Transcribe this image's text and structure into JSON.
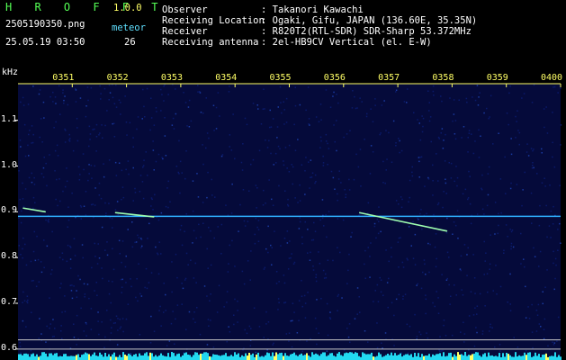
{
  "header": {
    "app_title": "H R O F F T",
    "app_version": "1.0.0",
    "filename": "2505190350.png",
    "datetime": "25.05.19 03:50",
    "count_label": "meteor",
    "count_value": "26",
    "info": [
      {
        "label": "Observer",
        "value": ": Takanori Kawachi"
      },
      {
        "label": "Receiving Location",
        "value": ": Ogaki, Gifu, JAPAN (136.60E, 35.35N)"
      },
      {
        "label": "Receiver",
        "value": ": R820T2(RTL-SDR) SDR-Sharp 53.372MHz"
      },
      {
        "label": "Receiving antenna",
        "value": ": 2el-HB9CV Vertical (el. E-W)"
      }
    ]
  },
  "colors": {
    "background": "#000000",
    "cyan_text": "#5fe0ff",
    "yellow_text": "#ffff66",
    "green_text": "#55ff55",
    "noise": "#0a1a6a",
    "carrier": "#2fb0ff",
    "meteor": "#9fffb0"
  },
  "chart_data": {
    "type": "heatmap",
    "ylabel": "kHz",
    "y_ticks": [
      "1.1",
      "1.0",
      "0.9",
      "0.8",
      "0.7",
      "0.6"
    ],
    "x_ticks": [
      "0351",
      "0352",
      "0353",
      "0354",
      "0355",
      "0356",
      "0357",
      "0358",
      "0359",
      "0400"
    ],
    "ylim": [
      0.58,
      1.18
    ],
    "carrier_khz": 0.89,
    "meteor_echoes": [
      {
        "start_min": 0.1,
        "end_min": 0.5,
        "start_khz": 0.908,
        "end_khz": 0.9
      },
      {
        "start_min": 1.8,
        "end_min": 2.5,
        "start_khz": 0.898,
        "end_khz": 0.889
      },
      {
        "start_min": 6.3,
        "end_min": 7.9,
        "start_khz": 0.898,
        "end_khz": 0.858
      }
    ],
    "reference_lines_khz": [
      0.62,
      0.6
    ]
  }
}
